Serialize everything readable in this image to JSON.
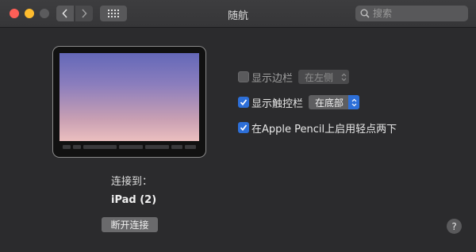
{
  "window": {
    "title": "随航"
  },
  "toolbar": {
    "search_placeholder": "搜索"
  },
  "device": {
    "connected_label": "连接到：",
    "name": "iPad (2)",
    "disconnect_label": "断开连接"
  },
  "options": {
    "sidebar": {
      "label": "显示边栏",
      "checked": false,
      "select_value": "在左侧"
    },
    "touchbar": {
      "label": "显示触控栏",
      "checked": true,
      "select_value": "在底部"
    },
    "pencil": {
      "label": "在Apple Pencil上启用轻点两下",
      "checked": true
    }
  },
  "help": {
    "label": "?"
  },
  "colors": {
    "accent": "#2d6fd8",
    "background": "#2b2b2d",
    "traffic_close": "#fe5f57",
    "traffic_minimize": "#febc2e"
  }
}
